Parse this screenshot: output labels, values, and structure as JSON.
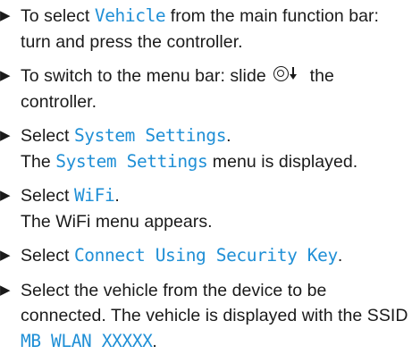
{
  "colors": {
    "text": "#1a1a1a",
    "highlight": "#1f8fd6"
  },
  "bullet_icon": "triangle-right-icon",
  "controller_symbol_icon": "slide-down-controller-icon",
  "steps": [
    {
      "pre": "To select ",
      "ui": "Vehicle",
      "post": " from the main function bar: turn and press the controller."
    },
    {
      "pre": "To switch to the menu bar: slide ",
      "post": " the controller."
    },
    {
      "pre": "Select ",
      "ui": "System Settings",
      "post": ".",
      "result_pre": "The ",
      "result_ui": "System Settings",
      "result_post": " menu is displayed."
    },
    {
      "pre": "Select ",
      "ui": "WiFi",
      "post": ".",
      "result": "The WiFi menu appears."
    },
    {
      "pre": "Select ",
      "ui": "Connect Using Security Key",
      "post": "."
    },
    {
      "pre": "Select the vehicle from the device to be connected. The vehicle is displayed with the SSID ",
      "ui": "MB WLAN XXXXX",
      "post": "."
    }
  ]
}
